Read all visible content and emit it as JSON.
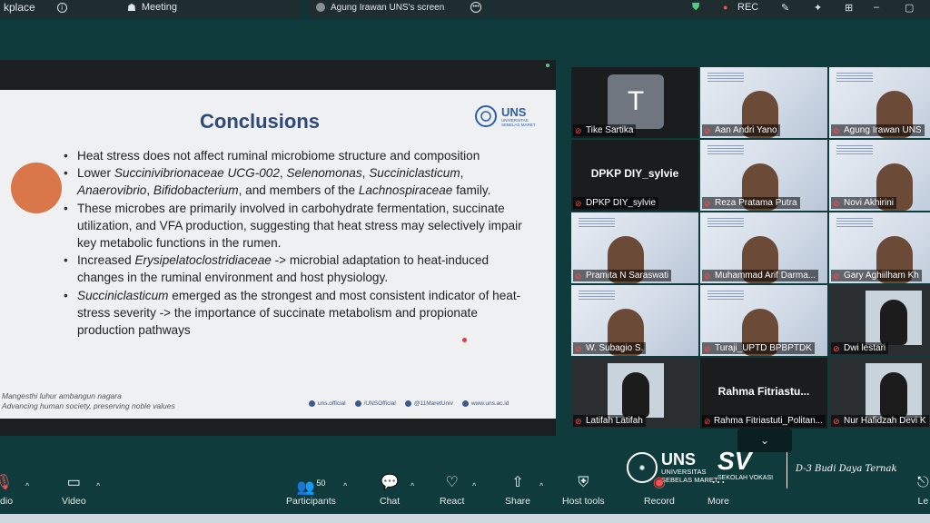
{
  "topbar": {
    "app_fragment": "kplace",
    "meeting_label": "Meeting",
    "share_label": "Agung Irawan UNS's screen",
    "rec_label": "REC"
  },
  "slide": {
    "title": "Conclusions",
    "logo_text": "UNS",
    "logo_sub": "UNIVERSITAS SEBELAS MARET",
    "bullets": [
      {
        "parts": [
          "Heat stress does not affect ruminal microbiome structure and composition"
        ]
      },
      {
        "parts": [
          "Lower ",
          "Succinivibrionaceae UCG-002",
          ", ",
          "Selenomonas",
          ", ",
          "Succiniclasticum",
          ", ",
          "Anaerovibrio",
          ", ",
          "Bifidobacterium",
          ", and members of the ",
          "Lachnospiraceae",
          " family."
        ]
      },
      {
        "parts": [
          "These microbes are primarily involved in carbohydrate fermentation, succinate utilization, and VFA production, suggesting that heat stress may selectively impair key metabolic functions in the rumen."
        ]
      },
      {
        "parts": [
          "Increased ",
          "Erysipelatoclostridiaceae",
          " -> microbial adaptation to heat-induced changes in the ruminal environment and host physiology."
        ]
      },
      {
        "parts": [
          "Succiniclasticum",
          " emerged as the strongest and most consistent indicator of heat-stress severity -> the importance of succinate metabolism and propionate production pathways"
        ]
      }
    ],
    "footer_motto": "Mangesthi luhur ambangun nagara",
    "footer_motto_en": "Advancing human society, preserving noble values",
    "socials": [
      "uns.official",
      "/UNSOfficial",
      "@11MaretUniv",
      "www.uns.ac.id"
    ]
  },
  "gallery": [
    {
      "name": "Tike Sartika",
      "type": "avatar",
      "initial": "T"
    },
    {
      "name": "Aan Andri Yano",
      "type": "video"
    },
    {
      "name": "Agung Irawan UNS",
      "type": "video",
      "active": true
    },
    {
      "name": "DPKP DIY_sylvie",
      "type": "blank"
    },
    {
      "name": "Reza Pratama Putra",
      "type": "video"
    },
    {
      "name": "Novi Akhirini",
      "type": "video"
    },
    {
      "name": "Pramita N Saraswati",
      "type": "video"
    },
    {
      "name": "Muhammad Arif Darma...",
      "type": "video"
    },
    {
      "name": "Gary Aghiilham Kh",
      "type": "video"
    },
    {
      "name": "W. Subagio S.",
      "type": "video"
    },
    {
      "name": "Turaji_UPTD BPBPTDK",
      "type": "video"
    },
    {
      "name": "Dwi lestari",
      "type": "photo"
    },
    {
      "name": "Latifah Latifah",
      "type": "photo"
    },
    {
      "name": "Rahma Fitriastuti_Politan...",
      "type": "blank",
      "display_name": "Rahma  Fitriastu..."
    },
    {
      "name": "Nur Hafidzah Devi K",
      "type": "photo"
    }
  ],
  "branding": {
    "uns": "UNS",
    "uns_sub1": "UNIVERSITAS",
    "uns_sub2": "SEBELAS MARET",
    "sv": "SV",
    "sv_sub": "SEKOLAH VOKASI",
    "dept": "D-3 Budi Daya Ternak"
  },
  "controls": {
    "audio": "udio",
    "video": "Video",
    "participants": "Participants",
    "participants_count": "50",
    "chat": "Chat",
    "react": "React",
    "share": "Share",
    "host_tools": "Host tools",
    "record": "Record",
    "more": "More",
    "leave": "Le"
  },
  "colors": {
    "background": "#0f3b3d",
    "active_speaker": "#4ccf84",
    "muted": "#ff4d4d",
    "slide_title": "#2f4a7a"
  }
}
